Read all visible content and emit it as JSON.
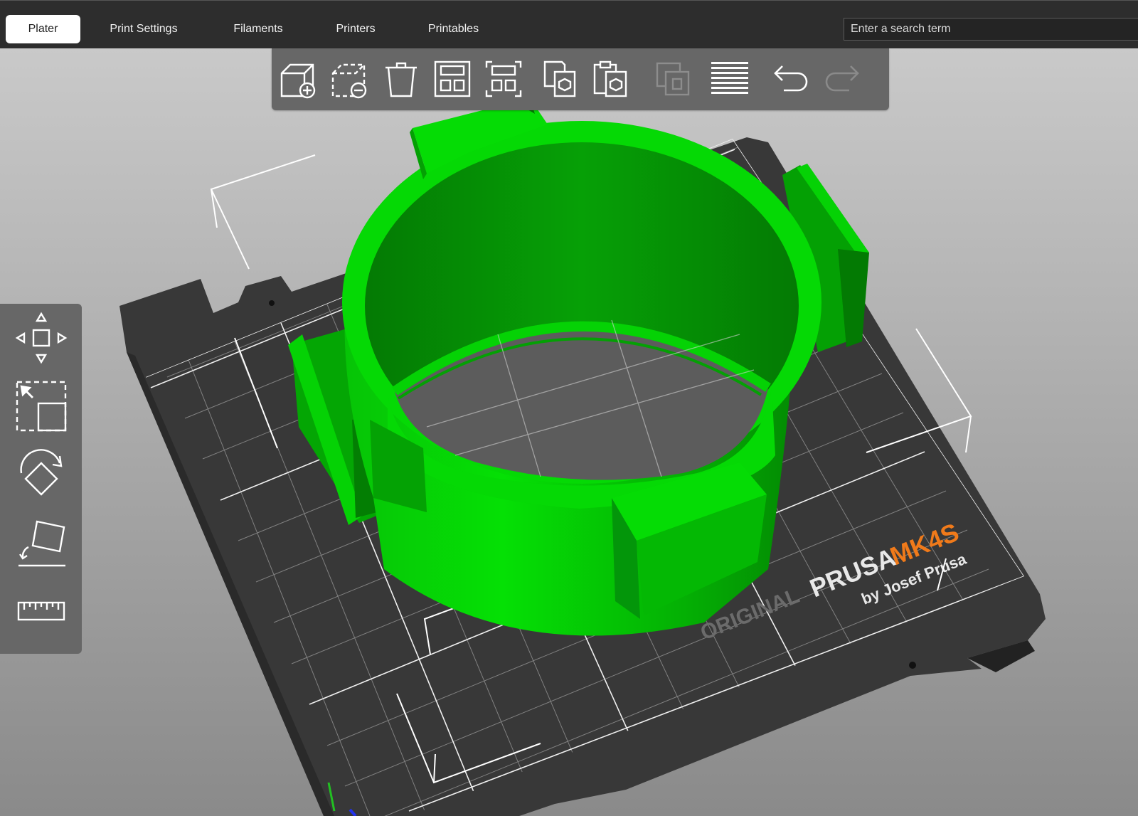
{
  "tabs": [
    {
      "label": "Plater",
      "active": true
    },
    {
      "label": "Print Settings",
      "active": false
    },
    {
      "label": "Filaments",
      "active": false
    },
    {
      "label": "Printers",
      "active": false
    },
    {
      "label": "Printables",
      "active": false
    }
  ],
  "search": {
    "placeholder": "Enter a search term",
    "value": ""
  },
  "toolbar": {
    "buttons": [
      {
        "icon": "add-icon",
        "enabled": true
      },
      {
        "icon": "delete-icon",
        "enabled": true
      },
      {
        "icon": "delete-all-icon",
        "enabled": true
      },
      {
        "icon": "arrange-icon",
        "enabled": true
      },
      {
        "icon": "arrange-selection-icon",
        "enabled": true
      },
      {
        "icon": "copy-icon",
        "enabled": true
      },
      {
        "icon": "paste-icon",
        "enabled": true
      },
      {
        "icon": "instances-icon",
        "enabled": false
      },
      {
        "icon": "layers-icon",
        "enabled": true
      },
      {
        "icon": "undo-icon",
        "enabled": true
      },
      {
        "icon": "redo-icon",
        "enabled": false
      }
    ]
  },
  "gizmos": [
    "move-icon",
    "scale-icon",
    "rotate-icon",
    "place-on-face-icon",
    "measure-icon"
  ],
  "bed": {
    "logo_original": "ORIGINAL",
    "logo_prusa": "PRUSA",
    "logo_model": "MK4S",
    "logo_by": "by Josef Prusa"
  },
  "colors": {
    "model": "#05d205",
    "model_dark": "#039a03",
    "accent": "#f07a1a",
    "bed": "#3a3a3a"
  }
}
